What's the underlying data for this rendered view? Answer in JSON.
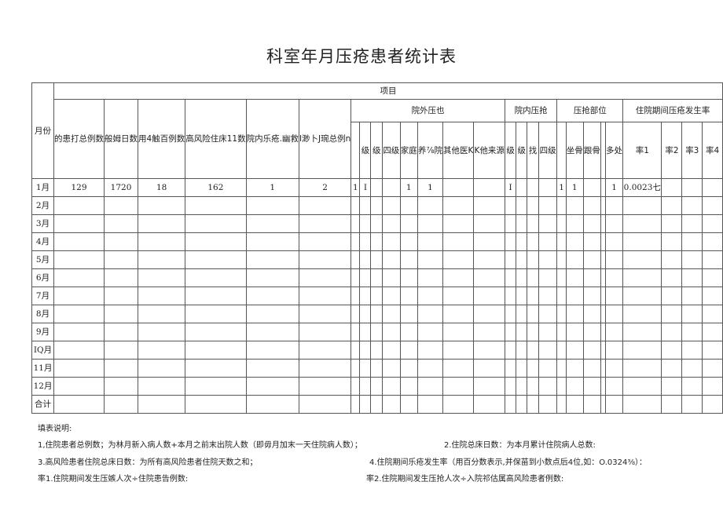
{
  "title": "科室年月压疮患者统计表",
  "table": {
    "month_header": "月份",
    "project_header": "项目",
    "basic_columns": [
      "的患打总例数",
      "般姆日数",
      "用4触百例数",
      "高风险住床11数",
      "院内乐疮.幽救",
      "I渺卜J琬总例n"
    ],
    "groups": {
      "outside": "院外压也",
      "inside": "院内压抢",
      "site": "压抢部位",
      "rate": "住院期间压疮发生率"
    },
    "outside_columns": [
      "",
      "级",
      "级",
      "四级",
      "家庭",
      "养⅞院",
      "其他医K",
      "K他来源"
    ],
    "inside_columns": [
      "级",
      "级",
      "找",
      "四级"
    ],
    "site_columns": [
      "",
      "坐骨",
      "跟骨",
      "",
      "多处"
    ],
    "rate_columns": [
      "率1",
      "率2",
      "率3",
      "率4"
    ],
    "rows": [
      {
        "month": "1月",
        "cells": [
          "129",
          "1720",
          "18",
          "162",
          "1",
          "2",
          "1",
          "I",
          "",
          "",
          "1",
          "1",
          "",
          "",
          "I",
          "",
          "",
          "",
          "1",
          "1",
          "",
          "",
          "1",
          "0.0023七",
          "",
          "",
          ""
        ]
      },
      {
        "month": "2月",
        "cells": []
      },
      {
        "month": "3月",
        "cells": []
      },
      {
        "month": "4月",
        "cells": []
      },
      {
        "month": "5月",
        "cells": []
      },
      {
        "month": "6月",
        "cells": []
      },
      {
        "month": "7月",
        "cells": []
      },
      {
        "month": "8月",
        "cells": []
      },
      {
        "month": "9月",
        "cells": []
      },
      {
        "month": "IQ月",
        "cells": []
      },
      {
        "month": "11月",
        "cells": []
      },
      {
        "month": "12月",
        "cells": []
      },
      {
        "month": "合计",
        "cells": []
      }
    ]
  },
  "notes": {
    "heading": "填表说明:",
    "n1": "1,住院患者总例数；为林月新入病人数+本月之前末出院人数（即毋月加末一天住院病人数）；",
    "n2": "2.住院总床日数：为本月累计住院病人总数:",
    "n3": "3.高风险患者住院总床日数：为所有高风险患者住院天数之和；",
    "n4": "4.住院期间乐疮发生率（用百分数表示,并保苗到小数点后4位,如：O.0324⅜）：",
    "r1": "率1.住院期间发生压嫉人次÷住院患告例数:",
    "r2": "率2.住院期间发生压抢人次÷入院祁估属高风险患者例数:"
  }
}
